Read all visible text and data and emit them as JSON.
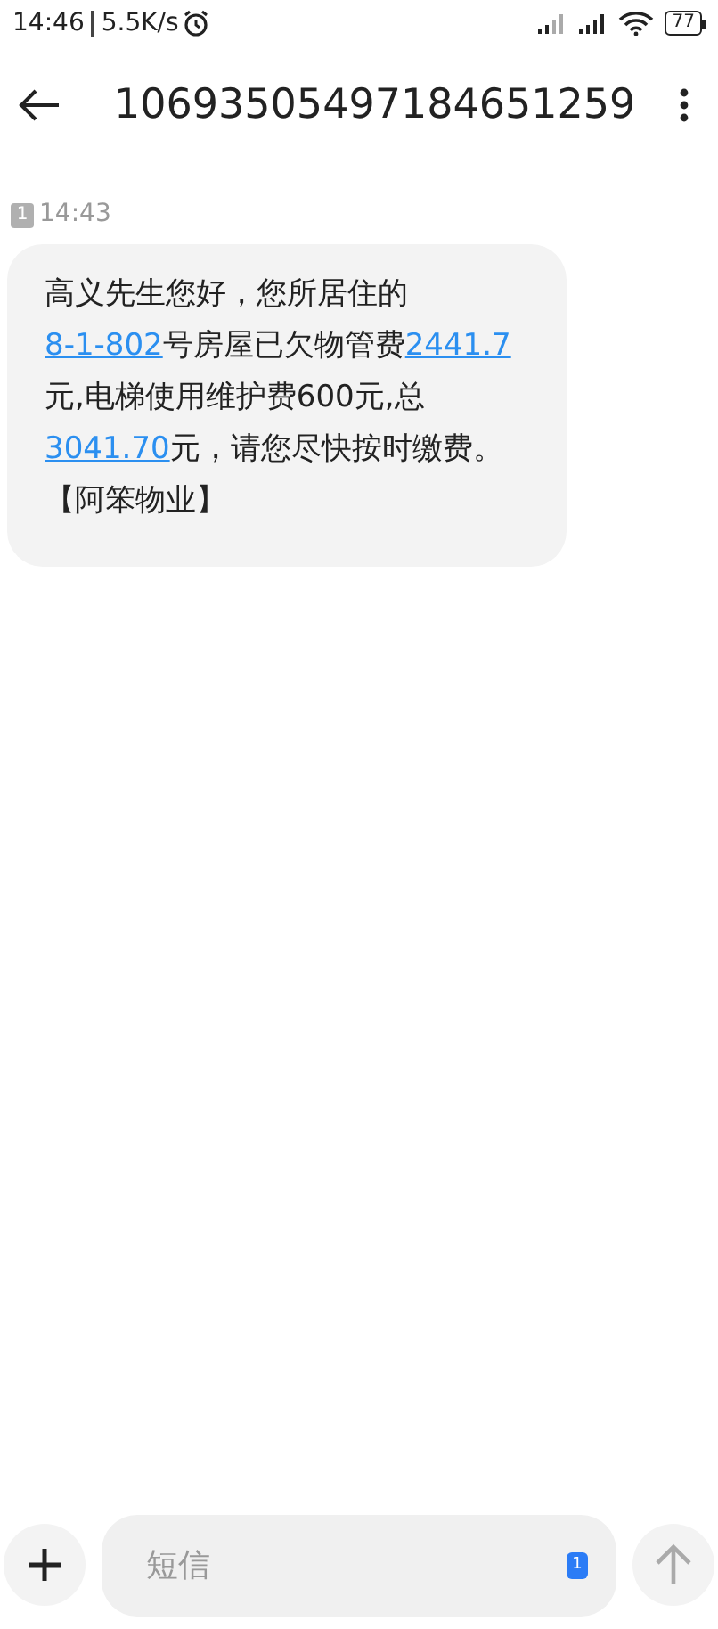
{
  "status_bar": {
    "time": "14:46",
    "speed": "5.5K/s",
    "battery": "77"
  },
  "header": {
    "title": "10693505497184651259"
  },
  "message": {
    "sim": "1",
    "time": "14:43",
    "lines": [
      [
        {
          "kind": "text",
          "text": "高义先生您好，您所居住的"
        }
      ],
      [
        {
          "kind": "link",
          "text": "8-1-802"
        },
        {
          "kind": "text",
          "text": "号房屋已欠物管费"
        },
        {
          "kind": "link",
          "text": "2441.7"
        }
      ],
      [
        {
          "kind": "text",
          "text": "元,电梯使用维护费600元,总"
        }
      ],
      [
        {
          "kind": "link",
          "text": "3041.70"
        },
        {
          "kind": "text",
          "text": "元，请您尽快按时缴费。"
        }
      ],
      [
        {
          "kind": "text",
          "text": "【阿笨物业】"
        }
      ]
    ]
  },
  "composer": {
    "placeholder": "短信",
    "sim": "1"
  }
}
